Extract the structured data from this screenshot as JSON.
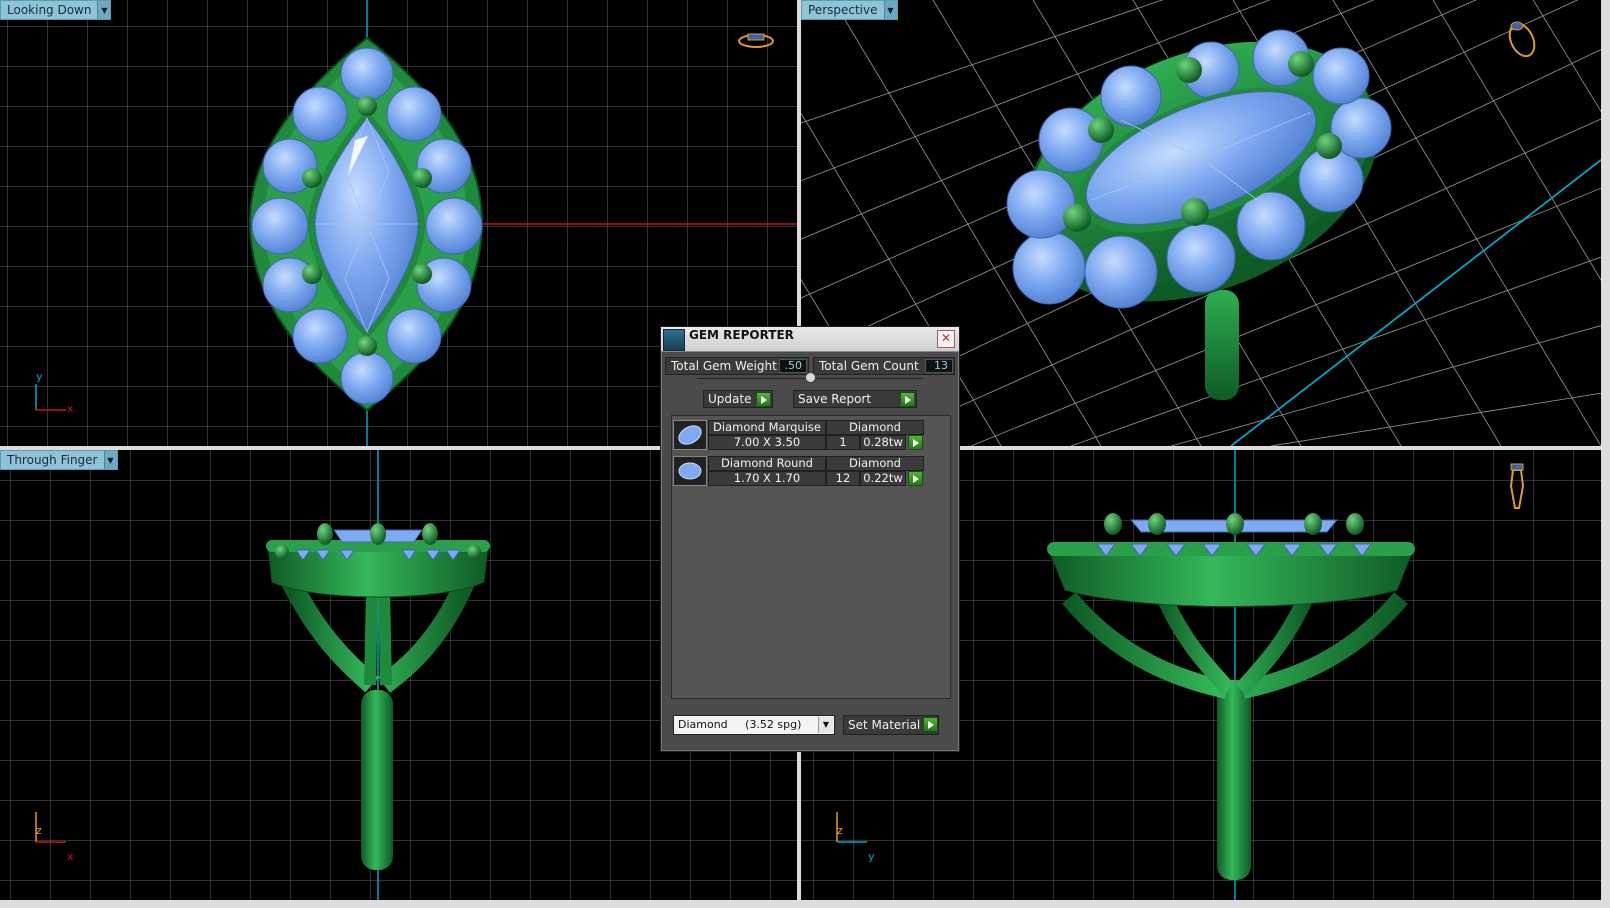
{
  "viewports": {
    "top_left": {
      "label": "Looking Down",
      "axis_v": "y",
      "axis_h": "x"
    },
    "top_right": {
      "label": "Perspective"
    },
    "bottom_left": {
      "label": "Through Finger",
      "axis_v": "z",
      "axis_h": "x"
    },
    "bottom_right": {
      "label": "",
      "axis_v": "z",
      "axis_h": "y"
    }
  },
  "gem_reporter": {
    "title": "GEM REPORTER",
    "total_weight_label": "Total Gem Weight",
    "total_weight_value": ".50",
    "total_count_label": "Total Gem Count",
    "total_count_value": "13",
    "update_label": "Update",
    "save_report_label": "Save Report",
    "rows": [
      {
        "name": "Diamond Marquise",
        "material": "Diamond",
        "size": "7.00 X 3.50",
        "qty": "1",
        "weight": "0.28tw"
      },
      {
        "name": "Diamond Round",
        "material": "Diamond",
        "size": "1.70 X 1.70",
        "qty": "12",
        "weight": "0.22tw"
      }
    ],
    "material_select": "Diamond     (3.52 spg)",
    "set_material_label": "Set Material"
  },
  "colors": {
    "grid": "#7e7e7e",
    "axis_cyan": "#00a6c8",
    "axis_red": "#c8141a",
    "metal": "#1f8a3c",
    "gem": "#7fa9f0",
    "label_bg": "#8fc4d8"
  }
}
